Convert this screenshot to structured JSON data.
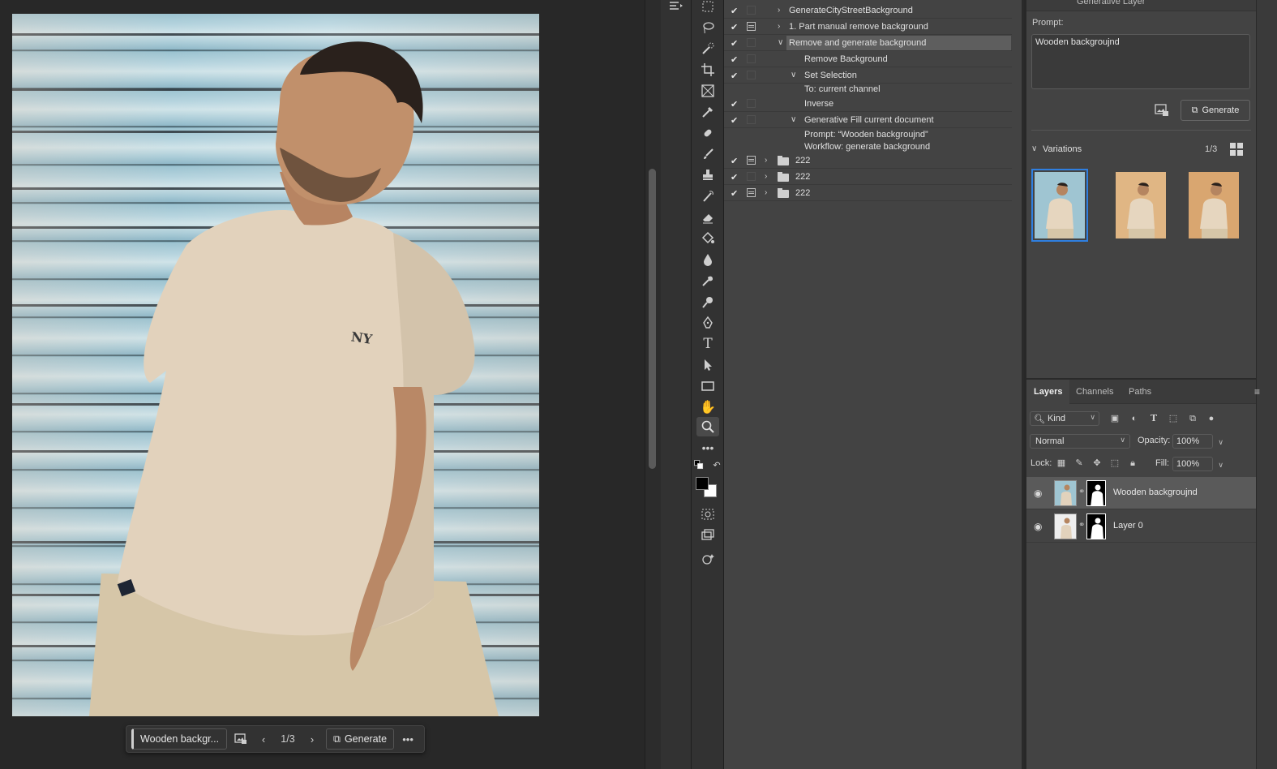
{
  "canvas": {
    "gen_bar": {
      "prompt_label": "Wooden backgr...",
      "counter": "1/3",
      "generate_label": "Generate"
    }
  },
  "actions": {
    "rows": [
      {
        "label": "GenerateCityStreetBackground",
        "checked": true,
        "dialog": false,
        "twisty": "collapsed",
        "indent": 0
      },
      {
        "label": "1. Part manual remove background",
        "checked": true,
        "dialog": true,
        "twisty": "collapsed",
        "indent": 0
      },
      {
        "label": "Remove and generate background",
        "checked": true,
        "dialog": false,
        "twisty": "expanded",
        "indent": 0,
        "selected": true
      },
      {
        "label": "Remove Background",
        "checked": true,
        "dialog": false,
        "twisty": "none",
        "indent": 1
      },
      {
        "label": "Set Selection",
        "checked": true,
        "dialog": false,
        "twisty": "expanded",
        "indent": 1
      },
      {
        "label": "To: current channel",
        "detail": true,
        "indent": 2
      },
      {
        "label": "Inverse",
        "checked": true,
        "dialog": false,
        "twisty": "none",
        "indent": 1
      },
      {
        "label": "Generative Fill current document",
        "checked": true,
        "dialog": false,
        "twisty": "expanded",
        "indent": 1
      },
      {
        "label": "Prompt:  “Wooden backgroujnd”",
        "detail": true,
        "indent": 2
      },
      {
        "label": "Workflow: generate background",
        "detail": true,
        "indent": 2
      },
      {
        "label": "222",
        "checked": true,
        "dialog": true,
        "twisty": "collapsed",
        "folder": true
      },
      {
        "label": "222",
        "checked": true,
        "dialog": false,
        "twisty": "collapsed",
        "folder": true
      },
      {
        "label": "222",
        "checked": true,
        "dialog": true,
        "twisty": "collapsed",
        "folder": true
      }
    ]
  },
  "properties": {
    "header_title": "Generative Layer",
    "prompt_label": "Prompt:",
    "prompt_value": "Wooden backgroujnd",
    "generate_label": "Generate",
    "variations_label": "Variations",
    "variations_count": "1/3",
    "thumbnails": [
      {
        "bg": "#9fc5d2",
        "selected": true
      },
      {
        "bg": "#e0b684",
        "selected": false
      },
      {
        "bg": "#d9a670",
        "selected": false
      }
    ]
  },
  "layers": {
    "tabs": [
      "Layers",
      "Channels",
      "Paths"
    ],
    "active_tab": "Layers",
    "kind_label": "Kind",
    "blend_mode": "Normal",
    "opacity_label": "Opacity:",
    "opacity_value": "100%",
    "lock_label": "Lock:",
    "fill_label": "Fill:",
    "fill_value": "100%",
    "items": [
      {
        "name": "Wooden backgroujnd",
        "selected": true,
        "visible": true
      },
      {
        "name": "Layer 0",
        "selected": false,
        "visible": true
      }
    ]
  },
  "colors": {
    "accent": "#2f7fe0",
    "foreground_swatch": "#000000",
    "background_swatch": "#ffffff"
  },
  "icons": {
    "tools": [
      "marquee-icon",
      "lasso-icon",
      "quick-selection-icon",
      "crop-icon",
      "frame-icon",
      "eyedropper-icon",
      "healing-brush-icon",
      "brush-icon",
      "clone-stamp-icon",
      "history-brush-icon",
      "eraser-icon",
      "paint-bucket-icon",
      "blur-icon",
      "smudge-icon",
      "dodge-icon",
      "pen-icon",
      "type-icon",
      "path-selection-icon",
      "rectangle-icon",
      "hand-icon",
      "zoom-icon",
      "more-tools-icon"
    ]
  }
}
